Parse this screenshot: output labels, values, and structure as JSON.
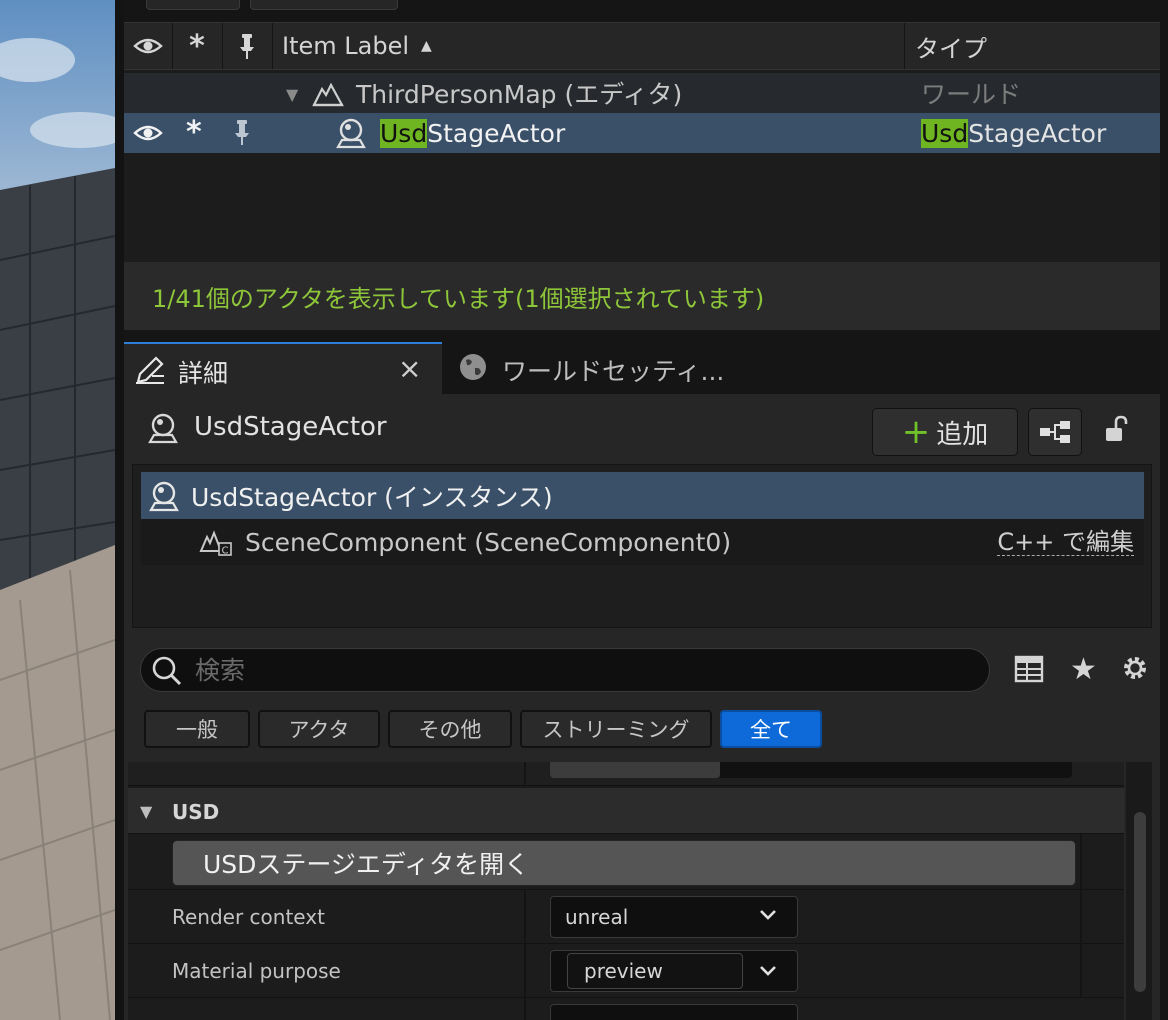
{
  "outliner": {
    "columns": {
      "item_label": "Item Label",
      "type": "タイプ"
    },
    "rows": [
      {
        "label": "ThirdPersonMap (エディタ)",
        "type": "ワールド"
      },
      {
        "label_highlight": "Usd",
        "label_rest": "StageActor",
        "type_highlight": "Usd",
        "type_rest": "StageActor"
      }
    ],
    "status": "1/41個のアクタを表示しています(1個選択されています)"
  },
  "tabs": [
    {
      "label": "詳細",
      "close": "×"
    },
    {
      "label": "ワールドセッティ..."
    }
  ],
  "details": {
    "actor_name": "UsdStageActor",
    "add_label": "追加",
    "components": {
      "root": "UsdStageActor (インスタンス)",
      "child": "SceneComponent (SceneComponent0)",
      "edit_link": "C++ で編集"
    },
    "search_placeholder": "検索",
    "filters": [
      "一般",
      "アクタ",
      "その他",
      "ストリーミング",
      "全て"
    ],
    "active_filter": "全て",
    "sections": {
      "usd": {
        "title": "USD",
        "open_editor_button": "USDステージエディタを開く",
        "properties": [
          {
            "label": "Render context",
            "value": "unreal"
          },
          {
            "label": "Material purpose",
            "value": "preview"
          }
        ]
      }
    }
  },
  "colors": {
    "accent": "#0d6ad8",
    "selection": "#3a5068",
    "highlight": "#6fb521",
    "status_text": "#8ec63a"
  }
}
